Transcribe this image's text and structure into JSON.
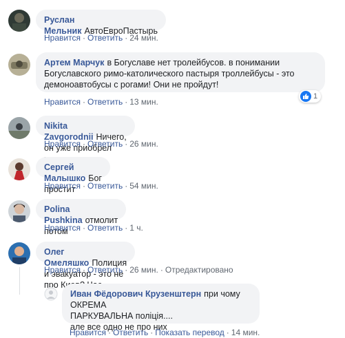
{
  "comments": [
    {
      "author": "Руслан Мельник",
      "text": "АвтоЕвроПастырь",
      "like": "Нравится",
      "reply": "Ответить",
      "time": "24 мин."
    },
    {
      "author": "Артем Марчук",
      "text_line1": "в Богуславе нет тролейбусов. в понимании",
      "text_line2": "Богуславского римо-католического пастыря троллейбусы - это",
      "text_line3": "демоноавтобусы с рогами! Они не пройдут!",
      "like": "Нравится",
      "reply": "Ответить",
      "time": "13 мин.",
      "reaction_count": "1"
    },
    {
      "author": "Nikita Zavgorodnii",
      "text": "Ничего, он уже приобрел индульгенцию.",
      "like": "Нравится",
      "reply": "Ответить",
      "time": "26 мин."
    },
    {
      "author": "Сергей Малышко",
      "text": "Бог простит",
      "like": "Нравится",
      "reply": "Ответить",
      "time": "54 мин."
    },
    {
      "author": "Polina Pushkina",
      "text": "отмолит потом",
      "like": "Нравится",
      "reply": "Ответить",
      "time": "1 ч."
    },
    {
      "author": "Олег Омеляшко",
      "text": "Полиция и эвакуатор - это не про Киев? Час...",
      "like": "Нравится",
      "reply": "Ответить",
      "time": "26 мин.",
      "edited": "Отредактировано"
    }
  ],
  "reply": {
    "author": "Иван Фёдорович Крузенштерн",
    "text_line1": "при чому ОКРЕМА",
    "text_line2": "ПАРКУВАЛЬНА поліція....",
    "text_line3": "але все одно не про них",
    "like": "Нравится",
    "reply": "Ответить",
    "translate": "Показать перевод",
    "time": "14 мин."
  },
  "colors": {
    "name": "#385898",
    "bubble": "#f2f3f5",
    "meta": "#606770",
    "like_blue": "#1877f2"
  }
}
